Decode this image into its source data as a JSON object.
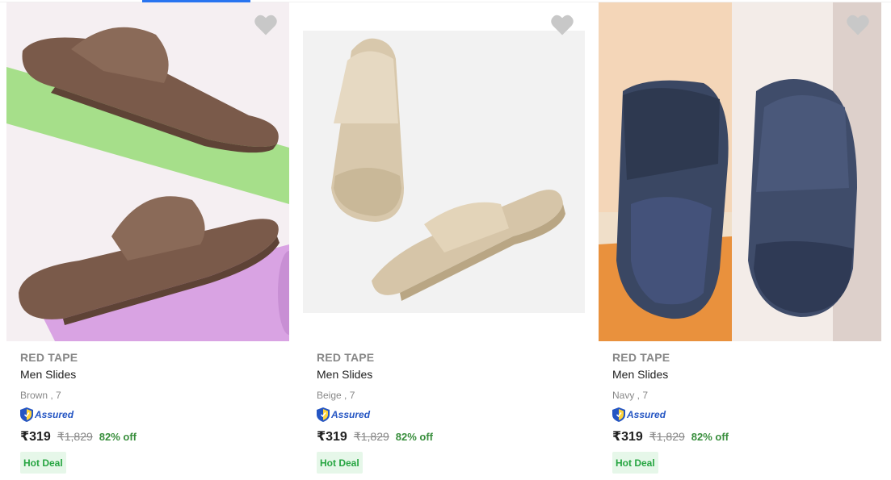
{
  "products": [
    {
      "brand": "RED TAPE",
      "title": "Men Slides",
      "variant": "Brown , 7",
      "assured": "Assured",
      "price": "₹319",
      "mrp": "₹1,829",
      "discount": "82% off",
      "badge": "Hot Deal",
      "color": "#7e5d4d",
      "bg": "#f3eef0"
    },
    {
      "brand": "RED TAPE",
      "title": "Men Slides",
      "variant": "Beige , 7",
      "assured": "Assured",
      "price": "₹319",
      "mrp": "₹1,829",
      "discount": "82% off",
      "badge": "Hot Deal",
      "color": "#d9c9ad",
      "bg": "#f2f2f2"
    },
    {
      "brand": "RED TAPE",
      "title": "Men Slides",
      "variant": "Navy , 7",
      "assured": "Assured",
      "price": "₹319",
      "mrp": "₹1,829",
      "discount": "82% off",
      "badge": "Hot Deal",
      "color": "#384560",
      "bg": "#e9a445"
    }
  ],
  "colors": {
    "accent": "#2874f0",
    "discount_green": "#388e3c",
    "badge_bg": "#e6f7e9",
    "badge_text": "#26a541",
    "heart": "#c8c8c8"
  }
}
